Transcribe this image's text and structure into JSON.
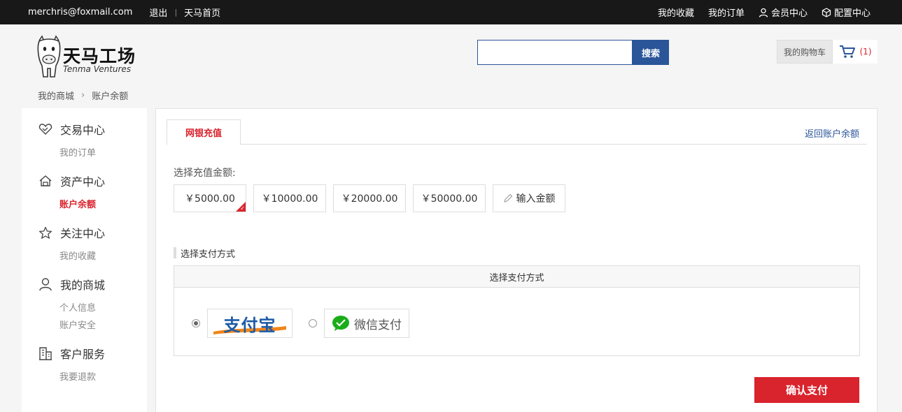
{
  "topbar": {
    "email": "merchris@foxmail.com",
    "logout": "退出",
    "home": "天马首页",
    "favorites": "我的收藏",
    "orders": "我的订单",
    "member": "会员中心",
    "config": "配置中心"
  },
  "header": {
    "logo_text": "天马工场",
    "logo_sub": "Tenma Ventures",
    "search_placeholder": "",
    "search_button": "搜索",
    "cart_label": "我的购物车",
    "cart_count": "(1)"
  },
  "breadcrumb": [
    "我的商城",
    "账户余额"
  ],
  "sidebar": {
    "sections": [
      {
        "title": "交易中心",
        "icon": "handshake-icon",
        "items": [
          "我的订单"
        ]
      },
      {
        "title": "资产中心",
        "icon": "house-icon",
        "items": [
          "账户余额"
        ]
      },
      {
        "title": "关注中心",
        "icon": "star-icon",
        "items": [
          "我的收藏"
        ]
      },
      {
        "title": "我的商城",
        "icon": "user-icon",
        "items": [
          "个人信息",
          "账户安全"
        ]
      },
      {
        "title": "客户服务",
        "icon": "building-icon",
        "items": [
          "我要退款"
        ]
      }
    ],
    "active_item": "账户余额"
  },
  "main": {
    "tab_active": "网银充值",
    "back_link": "返回账户余额",
    "amount_label": "选择充值金额:",
    "amounts": [
      "￥5000.00",
      "￥10000.00",
      "￥20000.00",
      "￥50000.00"
    ],
    "selected_amount": "￥5000.00",
    "custom_amount": "输入金额",
    "pay_title": "选择支付方式",
    "pay_box_head": "选择支付方式",
    "pay_methods": [
      {
        "name": "支付宝",
        "selected": true
      },
      {
        "name": "微信支付",
        "selected": false
      }
    ],
    "confirm_button": "确认支付"
  },
  "colors": {
    "accent_red": "#d9232d",
    "accent_blue": "#2a5599",
    "topbar_bg": "#181818"
  }
}
